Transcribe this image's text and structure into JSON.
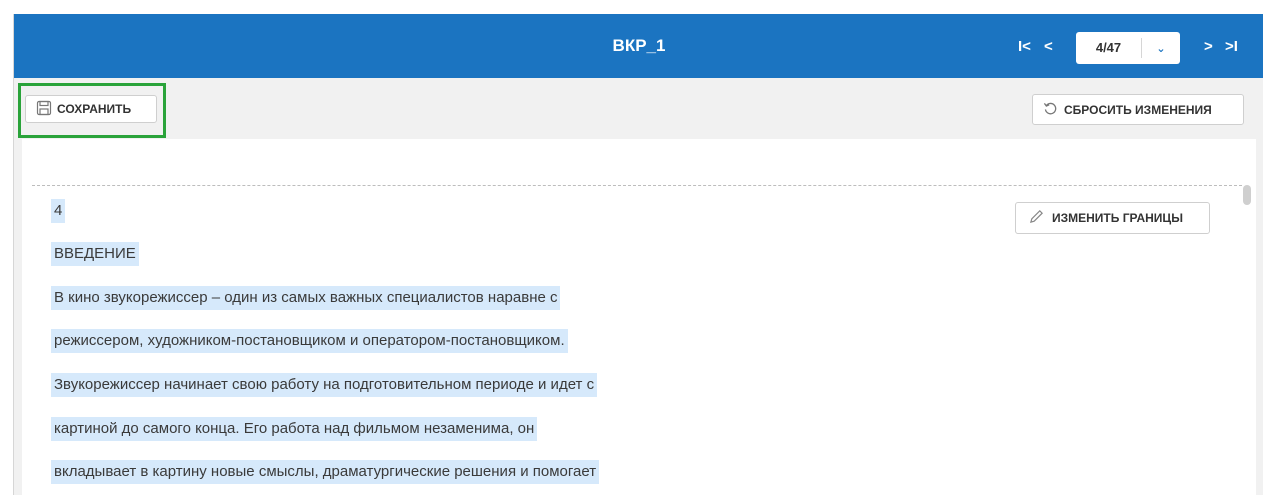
{
  "header": {
    "title": "ВКР_1",
    "nav_first": "I<",
    "nav_prev": "<",
    "nav_next": ">",
    "nav_last": ">I",
    "page_value": "4/47"
  },
  "toolbar": {
    "save_label": "СОХРАНИТЬ",
    "reset_label": "СБРОСИТЬ ИЗМЕНЕНИЯ"
  },
  "document": {
    "edit_bounds_label": "ИЗМЕНИТЬ ГРАНИЦЫ",
    "lines": [
      "4",
      "ВВЕДЕНИЕ",
      "В кино звукорежиссер – один из самых важных специалистов наравне с",
      "режиссером, художником-постановщиком и оператором-постановщиком.",
      "Звукорежиссер начинает свою работу на подготовительном периоде и идет с",
      "картиной до самого конца. Его работа над фильмом незаменима, он",
      "вкладывает в картину новые смыслы, драматургические решения и помогает"
    ]
  },
  "colors": {
    "header_bg": "#1b74c1",
    "highlight_border": "#2aa33a",
    "text_selection": "#d6e9fb"
  },
  "icons": [
    "first-page-icon",
    "prev-page-icon",
    "next-page-icon",
    "last-page-icon",
    "chevron-down-icon",
    "save-icon",
    "reset-icon",
    "pencil-icon"
  ]
}
